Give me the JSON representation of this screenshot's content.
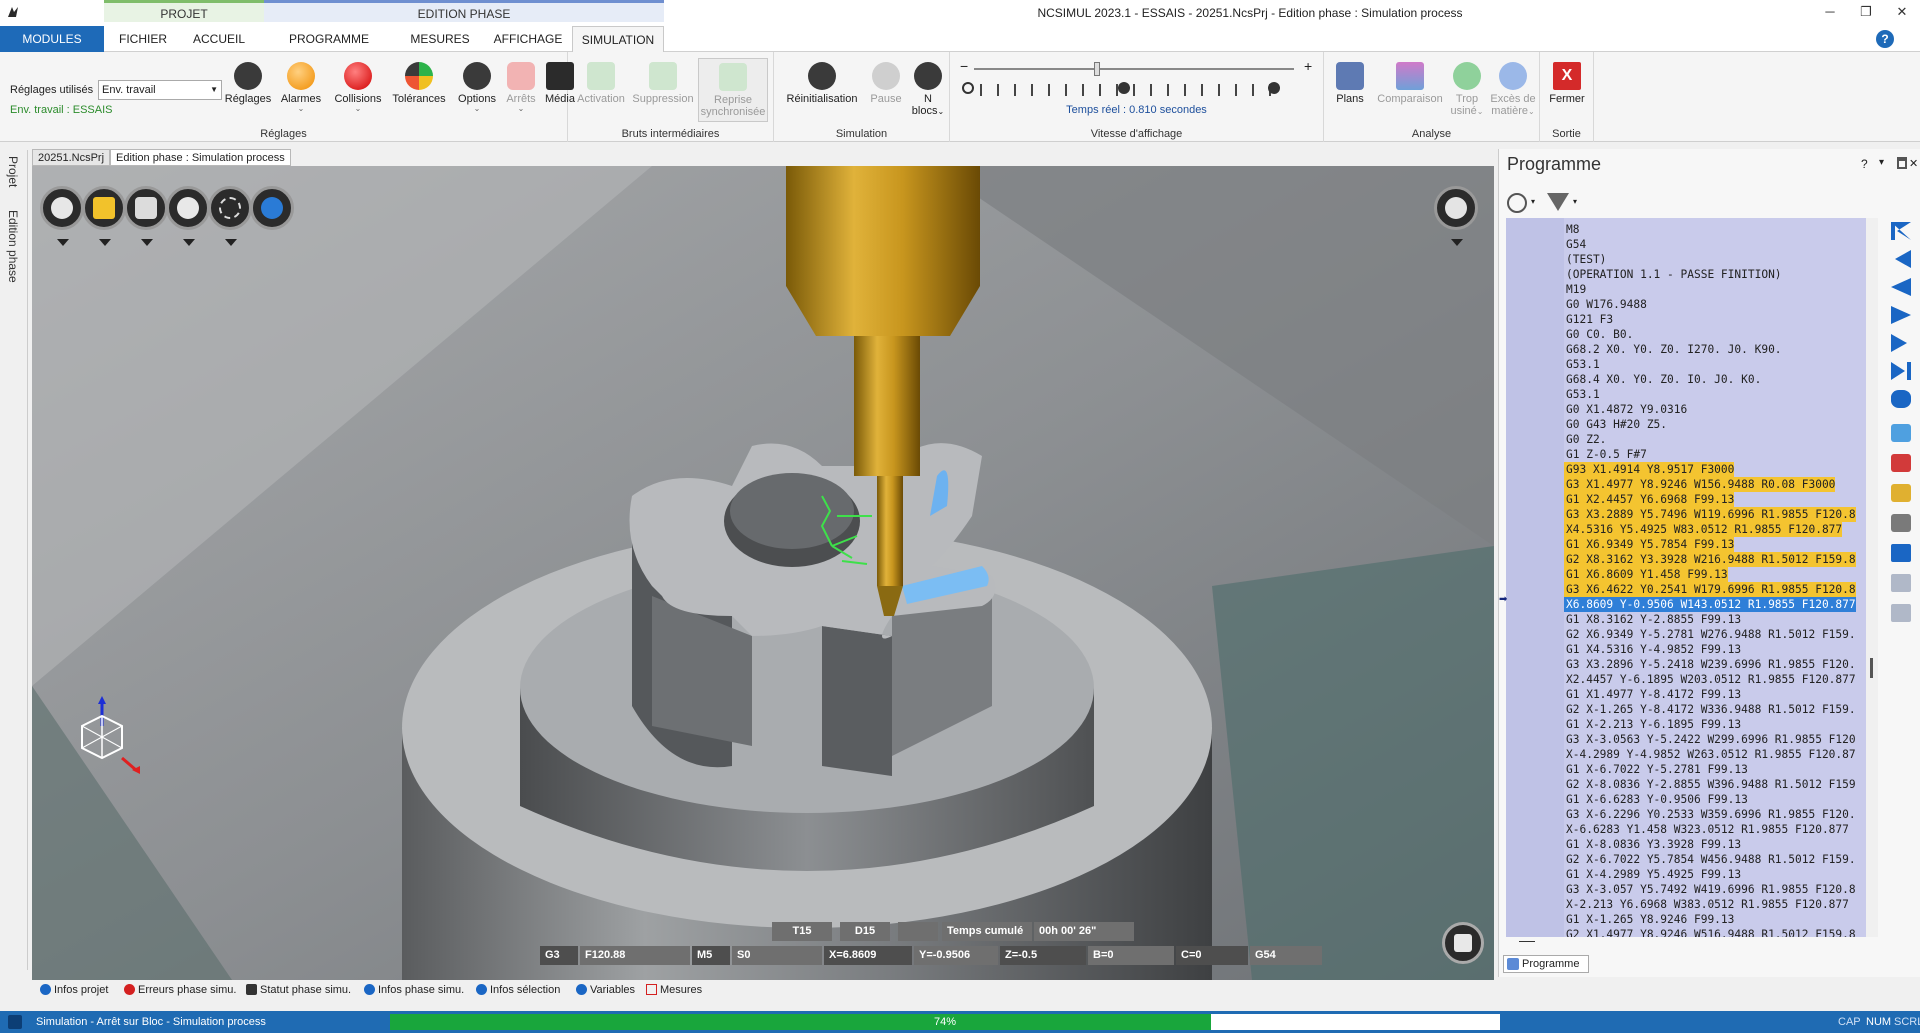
{
  "window": {
    "title": "NCSIMUL 2023.1 - ESSAIS - 20251.NcsPrj - Edition phase : Simulation process",
    "context_projet": "PROJET",
    "context_edition": "EDITION PHASE",
    "minimize": "─",
    "restore": "❐",
    "close": "✕"
  },
  "tabs": {
    "modules": "MODULES",
    "items": [
      "FICHIER",
      "ACCUEIL",
      "PROGRAMME",
      "MESURES",
      "AFFICHAGE",
      "SIMULATION"
    ],
    "active": "SIMULATION",
    "help": "?"
  },
  "ribbon": {
    "reglages_label": "Réglages utilisés",
    "reglages_value": "Env. travail",
    "env_label": "Env. travail : ESSAIS",
    "groups": {
      "reglages": {
        "label": "Réglages",
        "buttons": [
          "Réglages",
          "Alarmes",
          "Collisions",
          "Tolérances",
          "Options",
          "Arrêts",
          "Média"
        ]
      },
      "bruts": {
        "label": "Bruts intermédiaires",
        "buttons": [
          "Activation",
          "Suppression",
          "Reprise",
          "synchronisée"
        ]
      },
      "simulation": {
        "label": "Simulation",
        "buttons": [
          "Réinitialisation",
          "Pause",
          "N",
          "blocs"
        ]
      },
      "vitesse": {
        "label": "Vitesse d'affichage",
        "minus": "−",
        "plus": "+",
        "temps_reel": "Temps réel : 0.810 secondes"
      },
      "analyse": {
        "label": "Analyse",
        "buttons": [
          "Plans",
          "Comparaison",
          "Trop",
          "usiné",
          "Excès de",
          "matière"
        ]
      },
      "sortie": {
        "label": "Sortie",
        "buttons": [
          "Fermer"
        ]
      }
    }
  },
  "doctabs": [
    "20251.NcsPrj",
    "Edition phase : Simulation process"
  ],
  "leftrail": [
    "Projet",
    "Edition phase"
  ],
  "viewport": {
    "status": {
      "tool": "T15",
      "d": "D15",
      "temps_label": "Temps cumulé",
      "temps_value": "00h 00' 26\"",
      "g": "G3",
      "f": "F120.88",
      "m": "M5",
      "s": "S0",
      "x": "X=6.8609",
      "y": "Y=-0.9506",
      "z": "Z=-0.5",
      "b": "B=0",
      "c": "C=0",
      "wcs": "G54"
    }
  },
  "program": {
    "title": "Programme",
    "panel_controls": [
      "?",
      "▾",
      "✕"
    ],
    "tab_label": "Programme",
    "lines": [
      {
        "text": "M8",
        "state": "normal"
      },
      {
        "text": "G54",
        "state": "normal"
      },
      {
        "text": "(TEST)",
        "state": "normal"
      },
      {
        "text": "(OPERATION 1.1 - PASSE FINITION)",
        "state": "normal"
      },
      {
        "text": "M19",
        "state": "normal"
      },
      {
        "text": "G0 W176.9488",
        "state": "normal"
      },
      {
        "text": "G121 F3",
        "state": "normal"
      },
      {
        "text": "G0 C0. B0.",
        "state": "normal"
      },
      {
        "text": "G68.2 X0. Y0. Z0. I270. J0. K90.",
        "state": "normal"
      },
      {
        "text": "G53.1",
        "state": "normal"
      },
      {
        "text": "G68.4 X0. Y0. Z0. I0. J0. K0.",
        "state": "normal"
      },
      {
        "text": "G53.1",
        "state": "normal"
      },
      {
        "text": "G0 X1.4872 Y9.0316",
        "state": "normal"
      },
      {
        "text": "G0 G43 H#20 Z5.",
        "state": "normal"
      },
      {
        "text": "G0 Z2.",
        "state": "normal"
      },
      {
        "text": "G1 Z-0.5 F#7",
        "state": "normal"
      },
      {
        "text": "G93 X1.4914 Y8.9517 F3000",
        "state": "hl"
      },
      {
        "text": "G3 X1.4977 Y8.9246 W156.9488 R0.08 F3000",
        "state": "hl"
      },
      {
        "text": "G1 X2.4457 Y6.6968 F99.13",
        "state": "hl"
      },
      {
        "text": "G3 X3.2889 Y5.7496 W119.6996 R1.9855 F120.8",
        "state": "hl"
      },
      {
        "text": "X4.5316 Y5.4925 W83.0512 R1.9855 F120.877",
        "state": "hl"
      },
      {
        "text": "G1 X6.9349 Y5.7854 F99.13",
        "state": "hl"
      },
      {
        "text": "G2 X8.3162 Y3.3928 W216.9488 R1.5012 F159.8",
        "state": "hl"
      },
      {
        "text": "G1 X6.8609 Y1.458 F99.13",
        "state": "hl"
      },
      {
        "text": "G3 X6.4622 Y0.2541 W179.6996 R1.9855 F120.8",
        "state": "hl"
      },
      {
        "text": "X6.8609 Y-0.9506 W143.0512 R1.9855 F120.877",
        "state": "cur"
      },
      {
        "text": "G1 X8.3162 Y-2.8855 F99.13",
        "state": "normal"
      },
      {
        "text": "G2 X6.9349 Y-5.2781 W276.9488 R1.5012 F159.",
        "state": "normal"
      },
      {
        "text": "G1 X4.5316 Y-4.9852 F99.13",
        "state": "normal"
      },
      {
        "text": "G3 X3.2896 Y-5.2418 W239.6996 R1.9855 F120.",
        "state": "normal"
      },
      {
        "text": "X2.4457 Y-6.1895 W203.0512 R1.9855 F120.877",
        "state": "normal"
      },
      {
        "text": "G1 X1.4977 Y-8.4172 F99.13",
        "state": "normal"
      },
      {
        "text": "G2 X-1.265 Y-8.4172 W336.9488 R1.5012 F159.",
        "state": "normal"
      },
      {
        "text": "G1 X-2.213 Y-6.1895 F99.13",
        "state": "normal"
      },
      {
        "text": "G3 X-3.0563 Y-5.2422 W299.6996 R1.9855 F120",
        "state": "normal"
      },
      {
        "text": "X-4.2989 Y-4.9852 W263.0512 R1.9855 F120.87",
        "state": "normal"
      },
      {
        "text": "G1 X-6.7022 Y-5.2781 F99.13",
        "state": "normal"
      },
      {
        "text": "G2 X-8.0836 Y-2.8855 W396.9488 R1.5012 F159",
        "state": "normal"
      },
      {
        "text": "G1 X-6.6283 Y-0.9506 F99.13",
        "state": "normal"
      },
      {
        "text": "G3 X-6.2296 Y0.2533 W359.6996 R1.9855 F120.",
        "state": "normal"
      },
      {
        "text": "X-6.6283 Y1.458 W323.0512 R1.9855 F120.877",
        "state": "normal"
      },
      {
        "text": "G1 X-8.0836 Y3.3928 F99.13",
        "state": "normal"
      },
      {
        "text": "G2 X-6.7022 Y5.7854 W456.9488 R1.5012 F159.",
        "state": "normal"
      },
      {
        "text": "G1 X-4.2989 Y5.4925 F99.13",
        "state": "normal"
      },
      {
        "text": "G3 X-3.057 Y5.7492 W419.6996 R1.9855 F120.8",
        "state": "normal"
      },
      {
        "text": "X-2.213 Y6.6968 W383.0512 R1.9855 F120.877",
        "state": "normal"
      },
      {
        "text": "G1 X-1.265 Y8.9246 F99.13",
        "state": "normal"
      },
      {
        "text": "G2 X1.4977 Y8.9246 W516.9488 R1.5012 F159.8",
        "state": "normal"
      }
    ]
  },
  "infotabs": [
    "Infos projet",
    "Erreurs phase simu.",
    "Statut phase simu.",
    "Infos phase simu.",
    "Infos sélection",
    "Variables",
    "Mesures"
  ],
  "statusbar": {
    "text": "Simulation - Arrêt sur Bloc - Simulation process",
    "progress_label": "74%",
    "progress": 0.74,
    "keys": [
      "CAP",
      "NUM",
      "SCRL"
    ]
  },
  "colors": {
    "accent": "#1e6ab8",
    "progress": "#19a63c",
    "highlight": "#f4c430",
    "current_line": "#2f7fd8",
    "program_bg": "#c9cbeb"
  }
}
